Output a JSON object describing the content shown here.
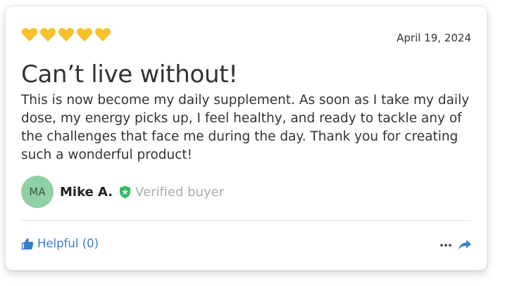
{
  "review": {
    "rating": 5,
    "rating_max": 5,
    "date": "April 19, 2024",
    "title": "Can’t live without!",
    "body": "This is now become my daily supplement. As soon as I take my daily dose, my energy picks up, I feel healthy, and ready to tackle any of the challenges that face me during the day. Thank you for creating such a wonderful product!",
    "author": {
      "initials": "MA",
      "name": "Mike A.",
      "badge_label": "Verified buyer",
      "badge_icon": "verified-shield-icon"
    },
    "helpful_label": "Helpful (0)",
    "icons": {
      "rating": "heart-icon",
      "helpful": "thumbs-up-icon",
      "more": "more-options-icon",
      "share": "share-arrow-icon"
    }
  },
  "colors": {
    "star": "#f8c12a",
    "avatar_bg": "#8fd0a5",
    "verified": "#2ebb5e",
    "link": "#3a7dc9",
    "text": "#333333",
    "muted": "#aaaaaa"
  }
}
